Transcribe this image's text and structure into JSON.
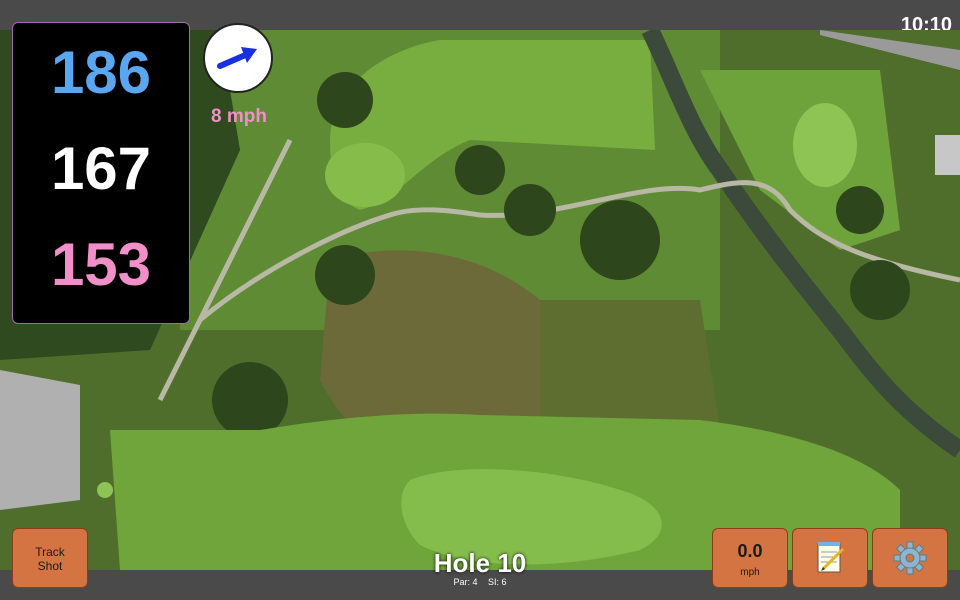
{
  "status_bar": {
    "time": "10:10"
  },
  "distances": {
    "back": "186",
    "middle": "167",
    "front": "153"
  },
  "wind": {
    "speed_label": "8 mph",
    "arrow_icon": "wind-direction-arrow-icon"
  },
  "buttons": {
    "track_shot_line1": "Track",
    "track_shot_line2": "Shot",
    "wind_value": "0.0",
    "wind_unit": "mph",
    "notes_icon": "notepad-icon",
    "settings_icon": "gear-icon"
  },
  "hole": {
    "title": "Hole 10",
    "par": "Par: 4",
    "si": "SI: 6"
  },
  "colors": {
    "back": "#5aa7f0",
    "middle": "#ffffff",
    "front": "#f08fc8",
    "button": "#d57443"
  }
}
